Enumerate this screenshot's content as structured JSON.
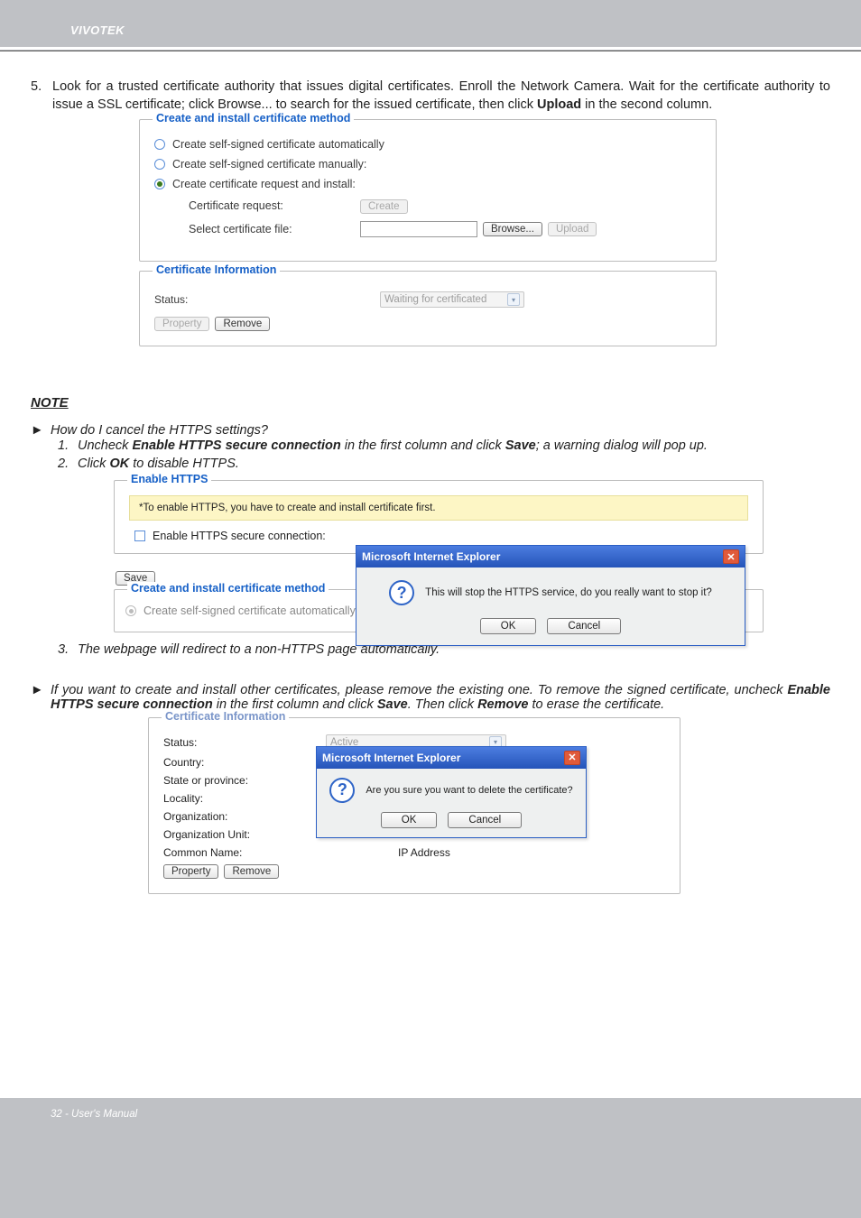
{
  "header": {
    "brand": "VIVOTEK"
  },
  "step5": {
    "num": "5.",
    "text_a": "Look for a trusted certificate authority that issues digital certificates. Enroll the Network Camera. Wait for the certificate authority to issue a SSL certificate; click Browse... to search for the issued certificate, then click ",
    "bold": "Upload",
    "text_b": " in the second column."
  },
  "fs1": {
    "legend": "Create and install certificate method",
    "opt1": "Create self-signed certificate automatically",
    "opt2": "Create self-signed certificate manually:",
    "opt3": "Create certificate request and install:",
    "req_lbl": "Certificate request:",
    "create_btn": "Create",
    "sel_lbl": "Select certificate file:",
    "browse_btn": "Browse...",
    "upload_btn": "Upload"
  },
  "fs2": {
    "legend": "Certificate Information",
    "status_lbl": "Status:",
    "status_val": "Waiting for certificated",
    "property_btn": "Property",
    "remove_btn": "Remove"
  },
  "note": {
    "heading": "NOTE",
    "q1": "How do I cancel the HTTPS settings?",
    "li1_a": "Uncheck ",
    "li1_bold1": "Enable HTTPS secure connection",
    "li1_b": " in the first column and click ",
    "li1_bold2": "Save",
    "li1_c": "; a warning dialog will pop up.",
    "li2_a": "Click ",
    "li2_bold": "OK",
    "li2_b": " to disable HTTPS.",
    "li3": "The webpage will redirect to a non-HTTPS page automatically.",
    "p2_a": "If you want to create and install other certificates, please remove the existing one. To remove the signed certificate, uncheck ",
    "p2_bold1": "Enable HTTPS secure connection",
    "p2_b": " in the first column and click ",
    "p2_bold2": "Save",
    "p2_c": ". Then click ",
    "p2_bold3": "Remove",
    "p2_d": " to erase the certificate."
  },
  "shot2": {
    "fs_enable": "Enable HTTPS",
    "yellow": "*To enable HTTPS, you have to create and install certificate first.",
    "chk_lbl": "Enable HTTPS secure connection:",
    "save_btn": "Save",
    "fs_method": "Create and install certificate method",
    "opt_auto": "Create self-signed certificate automatically",
    "dialog_title": "Microsoft Internet Explorer",
    "dialog_msg": "This will stop the HTTPS service, do you really want to stop it?",
    "ok": "OK",
    "cancel": "Cancel"
  },
  "shot3": {
    "legend": "Certificate Information",
    "status_lbl": "Status:",
    "status_val": "Active",
    "country": "Country:",
    "state": "State or province:",
    "locality": "Locality:",
    "org": "Organization:",
    "orgunit": "Organization Unit:",
    "cn_lbl": "Common Name:",
    "cn_val": "IP Address",
    "property_btn": "Property",
    "remove_btn": "Remove",
    "dialog_title": "Microsoft Internet Explorer",
    "dialog_msg": "Are you sure you want to delete the certificate?",
    "ok": "OK",
    "cancel": "Cancel"
  },
  "footer": "32 - User's Manual"
}
